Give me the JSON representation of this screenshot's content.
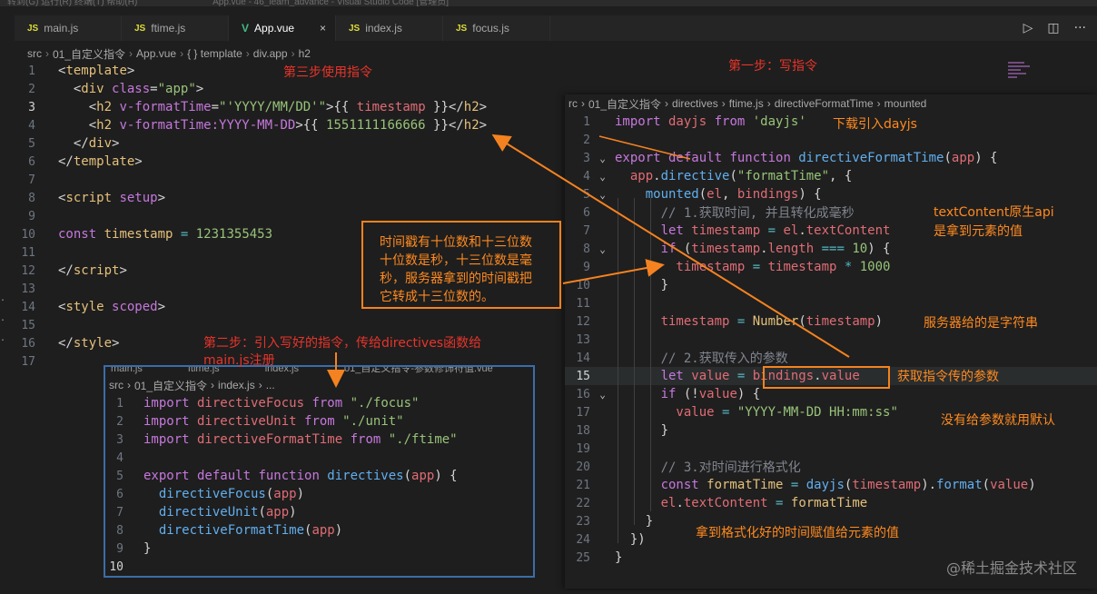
{
  "titlebar": {
    "menu_text": "转到(G)    运行(R)    终端(T)    帮助(H)",
    "window_title": "App.vue - 46_learn_advance - Visual Studio Code [管理员]"
  },
  "tabs": [
    {
      "label": "main.js",
      "icon": "js-icon",
      "badge": "JS"
    },
    {
      "label": "ftime.js",
      "icon": "js-icon",
      "badge": "JS"
    },
    {
      "label": "App.vue",
      "icon": "vue-icon",
      "badge": "V",
      "active": true,
      "close": "×"
    },
    {
      "label": "index.js",
      "icon": "js-icon",
      "badge": "JS"
    },
    {
      "label": "focus.js",
      "icon": "js-icon",
      "badge": "JS"
    }
  ],
  "tab_actions": {
    "run": "▷",
    "split": "◫",
    "more": "···"
  },
  "breadcrumb": {
    "items": [
      "src",
      "01_自定义指令",
      "App.vue",
      "{ } template",
      "div.app",
      "h2"
    ]
  },
  "main_editor": {
    "lines": [
      {
        "n": "1",
        "tokens": [
          {
            "c": "t-punc",
            "t": "<"
          },
          {
            "c": "t-tag",
            "t": "template"
          },
          {
            "c": "t-punc",
            "t": ">"
          }
        ]
      },
      {
        "n": "2",
        "tokens": [
          {
            "c": "t-punc",
            "t": "  <"
          },
          {
            "c": "t-tag",
            "t": "div"
          },
          {
            "c": "t-attr",
            "t": " class"
          },
          {
            "c": "t-punc",
            "t": "="
          },
          {
            "c": "t-str",
            "t": "\"app\""
          },
          {
            "c": "t-punc",
            "t": ">"
          }
        ]
      },
      {
        "n": "3",
        "cur": true,
        "tokens": [
          {
            "c": "t-punc",
            "t": "    <"
          },
          {
            "c": "t-tag",
            "t": "h2"
          },
          {
            "c": "t-attr",
            "t": " v-formatTime"
          },
          {
            "c": "t-punc",
            "t": "="
          },
          {
            "c": "t-str",
            "t": "\"'YYYY/MM/DD'\""
          },
          {
            "c": "t-punc",
            "t": ">{{ "
          },
          {
            "c": "t-prop",
            "t": "timestamp"
          },
          {
            "c": "t-punc",
            "t": " }}</"
          },
          {
            "c": "t-tag",
            "t": "h2"
          },
          {
            "c": "t-punc",
            "t": ">"
          }
        ]
      },
      {
        "n": "4",
        "tokens": [
          {
            "c": "t-punc",
            "t": "    <"
          },
          {
            "c": "t-tag",
            "t": "h2"
          },
          {
            "c": "t-attr",
            "t": " v-formatTime:YYYY-MM-DD"
          },
          {
            "c": "t-punc",
            "t": ">{{ "
          },
          {
            "c": "t-num",
            "t": "1551111166666"
          },
          {
            "c": "t-punc",
            "t": " }}</"
          },
          {
            "c": "t-tag",
            "t": "h2"
          },
          {
            "c": "t-punc",
            "t": ">"
          }
        ]
      },
      {
        "n": "5",
        "tokens": [
          {
            "c": "t-punc",
            "t": "  </"
          },
          {
            "c": "t-tag",
            "t": "div"
          },
          {
            "c": "t-punc",
            "t": ">"
          }
        ]
      },
      {
        "n": "6",
        "tokens": [
          {
            "c": "t-punc",
            "t": "</"
          },
          {
            "c": "t-tag",
            "t": "template"
          },
          {
            "c": "t-punc",
            "t": ">"
          }
        ]
      },
      {
        "n": "7",
        "tokens": []
      },
      {
        "n": "8",
        "tokens": [
          {
            "c": "t-punc",
            "t": "<"
          },
          {
            "c": "t-tag",
            "t": "script"
          },
          {
            "c": "t-attr",
            "t": " setup"
          },
          {
            "c": "t-punc",
            "t": ">"
          }
        ]
      },
      {
        "n": "9",
        "tokens": []
      },
      {
        "n": "10",
        "tokens": [
          {
            "c": "t-kw",
            "t": "const"
          },
          {
            "c": "t-var",
            "t": " timestamp"
          },
          {
            "c": "t-op",
            "t": " = "
          },
          {
            "c": "t-num",
            "t": "1231355453"
          }
        ]
      },
      {
        "n": "11",
        "tokens": []
      },
      {
        "n": "12",
        "tokens": [
          {
            "c": "t-punc",
            "t": "</"
          },
          {
            "c": "t-tag",
            "t": "script"
          },
          {
            "c": "t-punc",
            "t": ">"
          }
        ]
      },
      {
        "n": "13",
        "tokens": []
      },
      {
        "n": "14",
        "tokens": [
          {
            "c": "t-punc",
            "t": "<"
          },
          {
            "c": "t-tag",
            "t": "style"
          },
          {
            "c": "t-attr",
            "t": " scoped"
          },
          {
            "c": "t-punc",
            "t": ">"
          }
        ]
      },
      {
        "n": "15",
        "tokens": []
      },
      {
        "n": "16",
        "tokens": [
          {
            "c": "t-punc",
            "t": "</"
          },
          {
            "c": "t-tag",
            "t": "style"
          },
          {
            "c": "t-punc",
            "t": ">"
          }
        ]
      },
      {
        "n": "17",
        "tokens": []
      }
    ]
  },
  "bottom_panel": {
    "ghost_tabs": [
      "main.js",
      "ftime.js",
      "index.js",
      "01_自定义指令-参数修饰符值.vue"
    ],
    "breadcrumb": [
      "src",
      "01_自定义指令",
      "index.js",
      "..."
    ],
    "lines": [
      {
        "n": "1",
        "tokens": [
          {
            "c": "t-kw",
            "t": "import"
          },
          {
            "c": "t-prop",
            "t": " directiveFocus"
          },
          {
            "c": "t-kw",
            "t": " from"
          },
          {
            "c": "t-str",
            "t": " \"./focus\""
          }
        ]
      },
      {
        "n": "2",
        "tokens": [
          {
            "c": "t-kw",
            "t": "import"
          },
          {
            "c": "t-prop",
            "t": " directiveUnit"
          },
          {
            "c": "t-kw",
            "t": " from"
          },
          {
            "c": "t-str",
            "t": " \"./unit\""
          }
        ]
      },
      {
        "n": "3",
        "tokens": [
          {
            "c": "t-kw",
            "t": "import"
          },
          {
            "c": "t-prop",
            "t": " directiveFormatTime"
          },
          {
            "c": "t-kw",
            "t": " from"
          },
          {
            "c": "t-str",
            "t": " \"./ftime\""
          }
        ]
      },
      {
        "n": "4",
        "tokens": []
      },
      {
        "n": "5",
        "tokens": [
          {
            "c": "t-kw",
            "t": "export"
          },
          {
            "c": "t-kw",
            "t": " default"
          },
          {
            "c": "t-kw",
            "t": " function"
          },
          {
            "c": "t-fn",
            "t": " directives"
          },
          {
            "c": "t-punc",
            "t": "("
          },
          {
            "c": "t-prop",
            "t": "app"
          },
          {
            "c": "t-punc",
            "t": ") {"
          }
        ]
      },
      {
        "n": "6",
        "tokens": [
          {
            "c": "t-fn",
            "t": "  directiveFocus"
          },
          {
            "c": "t-punc",
            "t": "("
          },
          {
            "c": "t-prop",
            "t": "app"
          },
          {
            "c": "t-punc",
            "t": ")"
          }
        ]
      },
      {
        "n": "7",
        "tokens": [
          {
            "c": "t-fn",
            "t": "  directiveUnit"
          },
          {
            "c": "t-punc",
            "t": "("
          },
          {
            "c": "t-prop",
            "t": "app"
          },
          {
            "c": "t-punc",
            "t": ")"
          }
        ]
      },
      {
        "n": "8",
        "tokens": [
          {
            "c": "t-fn",
            "t": "  directiveFormatTime"
          },
          {
            "c": "t-punc",
            "t": "("
          },
          {
            "c": "t-prop",
            "t": "app"
          },
          {
            "c": "t-punc",
            "t": ")"
          }
        ]
      },
      {
        "n": "9",
        "tokens": [
          {
            "c": "t-punc",
            "t": "}"
          }
        ]
      },
      {
        "n": "10",
        "cur": true,
        "tokens": []
      }
    ]
  },
  "right_panel": {
    "breadcrumb": [
      "rc",
      "01_自定义指令",
      "directives",
      "ftime.js",
      "directiveFormatTime",
      "mounted"
    ],
    "lines": [
      {
        "n": "1",
        "f": "",
        "tokens": [
          {
            "c": "t-kw",
            "t": "import"
          },
          {
            "c": "t-prop",
            "t": " dayjs"
          },
          {
            "c": "t-kw",
            "t": " from"
          },
          {
            "c": "t-str",
            "t": " 'dayjs'"
          }
        ]
      },
      {
        "n": "2",
        "f": "",
        "tokens": []
      },
      {
        "n": "3",
        "f": "⌄",
        "tokens": [
          {
            "c": "t-kw",
            "t": "export"
          },
          {
            "c": "t-kw",
            "t": " default"
          },
          {
            "c": "t-kw",
            "t": " function"
          },
          {
            "c": "t-fn",
            "t": " directiveFormatTime"
          },
          {
            "c": "t-punc",
            "t": "("
          },
          {
            "c": "t-prop",
            "t": "app"
          },
          {
            "c": "t-punc",
            "t": ") {"
          }
        ]
      },
      {
        "n": "4",
        "f": "⌄",
        "tokens": [
          {
            "c": "t-prop",
            "t": "  app"
          },
          {
            "c": "t-punc",
            "t": "."
          },
          {
            "c": "t-fn",
            "t": "directive"
          },
          {
            "c": "t-punc",
            "t": "("
          },
          {
            "c": "t-str",
            "t": "\"formatTime\""
          },
          {
            "c": "t-punc",
            "t": ", {"
          }
        ]
      },
      {
        "n": "5",
        "f": "⌄",
        "tokens": [
          {
            "c": "t-fn",
            "t": "    mounted"
          },
          {
            "c": "t-punc",
            "t": "("
          },
          {
            "c": "t-prop",
            "t": "el"
          },
          {
            "c": "t-punc",
            "t": ", "
          },
          {
            "c": "t-prop",
            "t": "bindings"
          },
          {
            "c": "t-punc",
            "t": ") {"
          }
        ]
      },
      {
        "n": "6",
        "f": "",
        "tokens": [
          {
            "c": "t-cmt",
            "t": "      // 1.获取时间, 并且转化成毫秒"
          }
        ]
      },
      {
        "n": "7",
        "f": "",
        "tokens": [
          {
            "c": "t-kw",
            "t": "      let"
          },
          {
            "c": "t-prop",
            "t": " timestamp"
          },
          {
            "c": "t-op",
            "t": " = "
          },
          {
            "c": "t-prop",
            "t": "el"
          },
          {
            "c": "t-punc",
            "t": "."
          },
          {
            "c": "t-prop",
            "t": "textContent"
          }
        ]
      },
      {
        "n": "8",
        "f": "⌄",
        "tokens": [
          {
            "c": "t-kw",
            "t": "      if"
          },
          {
            "c": "t-punc",
            "t": " ("
          },
          {
            "c": "t-prop",
            "t": "timestamp"
          },
          {
            "c": "t-punc",
            "t": "."
          },
          {
            "c": "t-prop",
            "t": "length"
          },
          {
            "c": "t-op",
            "t": " === "
          },
          {
            "c": "t-num",
            "t": "10"
          },
          {
            "c": "t-punc",
            "t": ") {"
          }
        ]
      },
      {
        "n": "9",
        "f": "",
        "tokens": [
          {
            "c": "t-prop",
            "t": "        timestamp"
          },
          {
            "c": "t-op",
            "t": " = "
          },
          {
            "c": "t-prop",
            "t": "timestamp"
          },
          {
            "c": "t-op",
            "t": " * "
          },
          {
            "c": "t-num",
            "t": "1000"
          }
        ]
      },
      {
        "n": "10",
        "f": "",
        "tokens": [
          {
            "c": "t-punc",
            "t": "      }"
          }
        ]
      },
      {
        "n": "11",
        "f": "",
        "tokens": []
      },
      {
        "n": "12",
        "f": "",
        "tokens": [
          {
            "c": "t-prop",
            "t": "      timestamp"
          },
          {
            "c": "t-op",
            "t": " = "
          },
          {
            "c": "t-cls",
            "t": "Number"
          },
          {
            "c": "t-punc",
            "t": "("
          },
          {
            "c": "t-prop",
            "t": "timestamp"
          },
          {
            "c": "t-punc",
            "t": ")"
          }
        ]
      },
      {
        "n": "13",
        "f": "",
        "tokens": []
      },
      {
        "n": "14",
        "f": "",
        "tokens": [
          {
            "c": "t-cmt",
            "t": "      // 2.获取传入的参数"
          }
        ]
      },
      {
        "n": "15",
        "f": "",
        "cur": true,
        "tokens": [
          {
            "c": "t-kw",
            "t": "      let"
          },
          {
            "c": "t-prop",
            "t": " value"
          },
          {
            "c": "t-op",
            "t": " = "
          },
          {
            "c": "t-prop",
            "t": "bindings"
          },
          {
            "c": "t-punc",
            "t": "."
          },
          {
            "c": "t-prop",
            "t": "value"
          }
        ]
      },
      {
        "n": "16",
        "f": "⌄",
        "tokens": [
          {
            "c": "t-kw",
            "t": "      if"
          },
          {
            "c": "t-punc",
            "t": " (!"
          },
          {
            "c": "t-prop",
            "t": "value"
          },
          {
            "c": "t-punc",
            "t": ") {"
          }
        ]
      },
      {
        "n": "17",
        "f": "",
        "tokens": [
          {
            "c": "t-prop",
            "t": "        value"
          },
          {
            "c": "t-op",
            "t": " = "
          },
          {
            "c": "t-str",
            "t": "\"YYYY-MM-DD HH:mm:ss\""
          }
        ]
      },
      {
        "n": "18",
        "f": "",
        "tokens": [
          {
            "c": "t-punc",
            "t": "      }"
          }
        ]
      },
      {
        "n": "19",
        "f": "",
        "tokens": []
      },
      {
        "n": "20",
        "f": "",
        "tokens": [
          {
            "c": "t-cmt",
            "t": "      // 3.对时间进行格式化"
          }
        ]
      },
      {
        "n": "21",
        "f": "",
        "tokens": [
          {
            "c": "t-kw",
            "t": "      const"
          },
          {
            "c": "t-var",
            "t": " formatTime"
          },
          {
            "c": "t-op",
            "t": " = "
          },
          {
            "c": "t-fn",
            "t": "dayjs"
          },
          {
            "c": "t-punc",
            "t": "("
          },
          {
            "c": "t-prop",
            "t": "timestamp"
          },
          {
            "c": "t-punc",
            "t": ")."
          },
          {
            "c": "t-fn",
            "t": "format"
          },
          {
            "c": "t-punc",
            "t": "("
          },
          {
            "c": "t-prop",
            "t": "value"
          },
          {
            "c": "t-punc",
            "t": ")"
          }
        ]
      },
      {
        "n": "22",
        "f": "",
        "tokens": [
          {
            "c": "t-prop",
            "t": "      el"
          },
          {
            "c": "t-punc",
            "t": "."
          },
          {
            "c": "t-prop",
            "t": "textContent"
          },
          {
            "c": "t-op",
            "t": " = "
          },
          {
            "c": "t-var",
            "t": "formatTime"
          }
        ]
      },
      {
        "n": "23",
        "f": "",
        "tokens": [
          {
            "c": "t-punc",
            "t": "    }"
          }
        ]
      },
      {
        "n": "24",
        "f": "",
        "tokens": [
          {
            "c": "t-punc",
            "t": "  })"
          }
        ]
      },
      {
        "n": "25",
        "f": "",
        "tokens": [
          {
            "c": "t-punc",
            "t": "}"
          }
        ]
      }
    ]
  },
  "annotations": {
    "step3": "第三步使用指令",
    "step1": "第一步：写指令",
    "step2_line1": "第二步：引入写好的指令，传给directives函数给",
    "step2_line2": "main.js注册",
    "download": "下载引入dayjs",
    "textcontent_1": "textContent原生api",
    "textcontent_2": "是拿到元素的值",
    "server_string": "服务器给的是字符串",
    "get_param": "获取指令传的参数",
    "default_param": "没有给参数就用默认",
    "assign_value": "拿到格式化好的时间赋值给元素的值",
    "callout_lines": [
      "时间戳有十位数和十三位数",
      "十位数是秒，十三位数是毫",
      "秒，服务器拿到的时间戳把",
      "它转成十三位数的。"
    ]
  },
  "watermark": "@稀土掘金技术社区",
  "colors": {
    "annotation_red": "#e8342a",
    "annotation_orange": "#ff8a1f",
    "arrow": "#f58220"
  }
}
